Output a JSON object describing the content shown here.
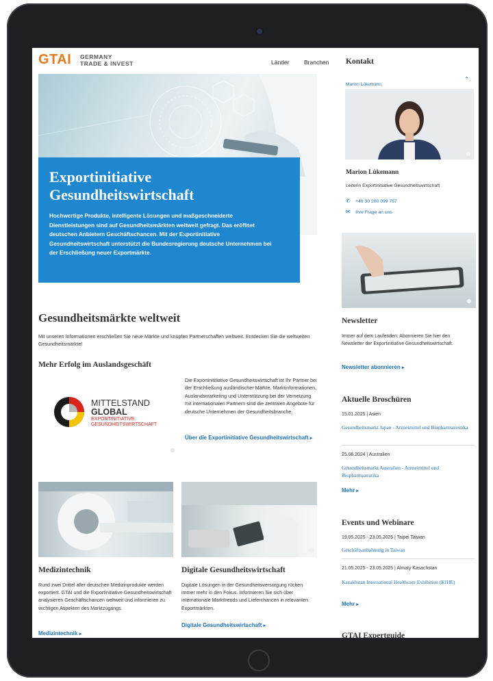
{
  "logo": {
    "mark": "GTAI",
    "line1": "GERMANY",
    "line2": "TRADE & INVEST"
  },
  "nav": {
    "items": [
      "Länder",
      "Branchen"
    ]
  },
  "hero": {
    "title_line1": "Exportinitiative",
    "title_line2": "Gesundheitswirtschaft",
    "text": "Hochwertige Produkte, intelligente Lösungen und maßgeschneiderte Dienstleistungen sind auf Gesundheitsmärkten weltweit gefragt. Das eröffnet deutschen Anbietern Geschäftschancen. Mit der Exportinitiative Gesundheitswirtschaft unterstützt die Bundesregierung deutsche Unternehmen bei der Erschließung neuer Exportmärkte."
  },
  "markets": {
    "title": "Gesundheitsmärkte weltweit",
    "intro": "Mit unseren Informationen erschließen Sie neue Märkte und knüpfen Partnerschaften weltweit. Entdecken Sie die weltweiten Gesundheitsmärkte!",
    "subtitle": "Mehr Erfolg im Auslandsgeschäft",
    "mg_logo": {
      "line1": "MITTELSTAND",
      "line2": "GLOBAL",
      "line3": "EXPORTINITIATIVE",
      "line4": "GESUNDHEITSWIRTSCHAFT"
    },
    "desc": "Die Exportinititiative Gesundheitswirtschaft ist Ihr Partner bei der Erschließung ausländischer Märkte. Marktinformationen, Auslandsmarketing und Unterstützung bei der Vernetzung mit internationalen Partnern sind die zentralen Angebote für deutsche Unternehmen der Gesundheitsbranche.",
    "link": "Über die Exportinitiative Gesundheitswirtschaft"
  },
  "cards": [
    {
      "title": "Medizintechnik",
      "text": "Rund zwei Drittel aller deutschen Medizinprodukte werden exportiert. GTAI und die Exportinitiative Gesundheitswirtschaft analysieren Geschäftschancen weltweit und informieren zu wichtigen Aspekten des Marktzugangs.",
      "link": "Medizintechnik"
    },
    {
      "title": "Digitale Gesundheitswirtschaft",
      "text": "Digitale Lösungen in der Gesundheitsversorgung rücken immer mehr in den Fokus. Informieren Sie sich über internationale Markttrends und Lieferchancen in relevanten Exportmärkten.",
      "link": "Digitale Gesundheitswirtschaft"
    }
  ],
  "sidebar": {
    "contact_title": "Kontakt",
    "contact_toggle": "Marion Lükemann",
    "contact_name": "Marion Lükemann",
    "contact_role": "Leiterin Exportinitiative Gesundheitswirtschaft",
    "contact_phone": "+49 30 200 099 757",
    "contact_ask": "Ihre Frage an uns",
    "newsletter_title": "Newsletter",
    "newsletter_text": "Immer auf dem Laufenden: Abonnieren Sie hier den Newsletter der Exportinitiative Gesundheitswirtschaft.",
    "newsletter_link": "Newsletter abonnieren",
    "brochures_title": "Aktuelle Broschüren",
    "brochures": [
      {
        "meta": "15.01.2025 | Asien",
        "title": "Gesundheitsmarkt Japan - Arzneimittel und Biopharmazeutika"
      },
      {
        "meta": "25.06.2024 | Australien",
        "title": "Gesundheitsmarkt Australien - Arzneimittel und Biopharmazeutika"
      }
    ],
    "brochures_more": "Mehr",
    "events_title": "Events und Webinare",
    "events": [
      {
        "meta": "19.05.2025 - 23.05.2025 | Taipei Taiwan",
        "title": "Geschäftsanbahnung in Taiwan"
      },
      {
        "meta": "21.05.2025 - 23.05.2025 | Almaty Kasachstan",
        "title": "Kazakhstan International Healthcare Exhibition (KIHE)"
      }
    ],
    "events_more": "Mehr",
    "expertguide_title": "GTAI Expertguide"
  },
  "colors": {
    "brand_blue": "#1d70b8",
    "hero_blue": "#1f86d0",
    "logo_orange": "#e37a1f",
    "device": "#1e1f22"
  }
}
